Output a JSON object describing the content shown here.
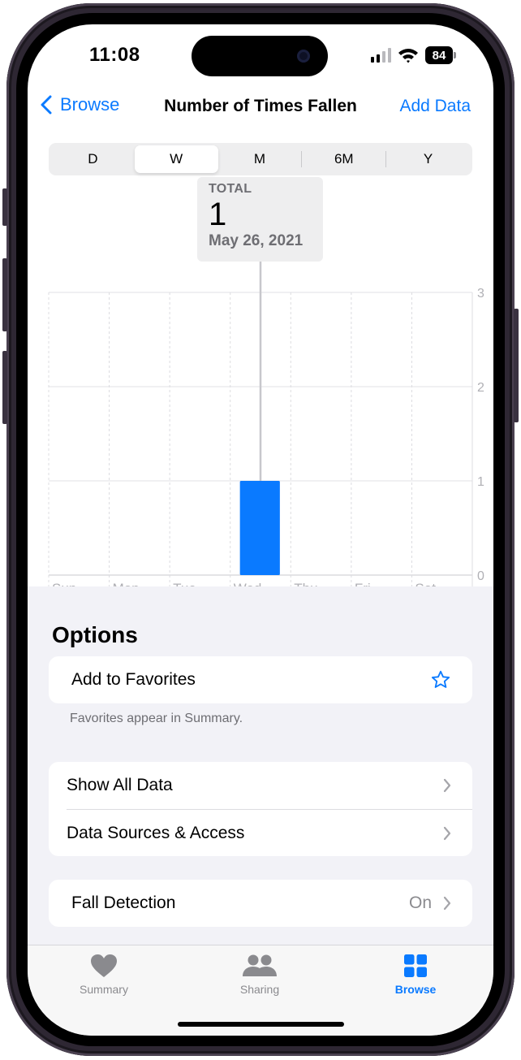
{
  "status_bar": {
    "time": "11:08",
    "battery": "84"
  },
  "nav": {
    "back_label": "Browse",
    "title": "Number of Times Fallen",
    "action_label": "Add Data"
  },
  "segments": [
    {
      "label": "D",
      "selected": false
    },
    {
      "label": "W",
      "selected": true
    },
    {
      "label": "M",
      "selected": false
    },
    {
      "label": "6M",
      "selected": false
    },
    {
      "label": "Y",
      "selected": false
    }
  ],
  "tooltip": {
    "label": "TOTAL",
    "value": "1",
    "date": "May 26, 2021"
  },
  "chart_data": {
    "type": "bar",
    "categories": [
      "Sun",
      "Mon",
      "Tue",
      "Wed",
      "Thu",
      "Fri",
      "Sat"
    ],
    "values": [
      0,
      0,
      0,
      1,
      0,
      0,
      0
    ],
    "y_ticks": [
      "0",
      "1",
      "2",
      "3"
    ],
    "ylim": [
      0,
      3
    ],
    "selected_category": "Wed",
    "grid": true,
    "color": "#0a7aff"
  },
  "options": {
    "title": "Options",
    "favorites_label": "Add to Favorites",
    "favorites_icon": "star-icon",
    "favorites_note": "Favorites appear in Summary.",
    "show_all_label": "Show All Data",
    "sources_label": "Data Sources & Access",
    "fall_detection_label": "Fall Detection",
    "fall_detection_value": "On"
  },
  "tabbar": {
    "tabs": [
      {
        "label": "Summary",
        "icon": "heart-icon",
        "active": false
      },
      {
        "label": "Sharing",
        "icon": "people-icon",
        "active": false
      },
      {
        "label": "Browse",
        "icon": "grid-icon",
        "active": true
      }
    ]
  },
  "colors": {
    "accent": "#0a7aff",
    "grouped_background": "#f2f2f7"
  }
}
